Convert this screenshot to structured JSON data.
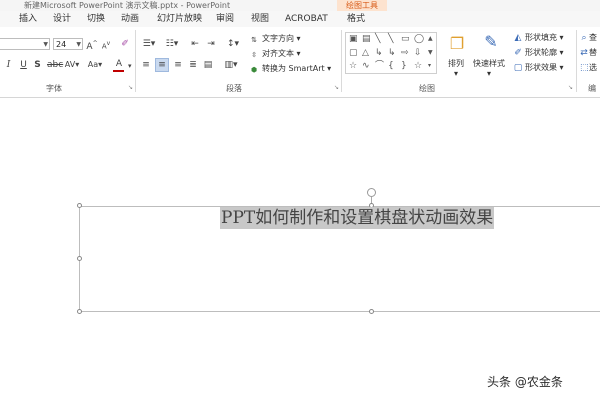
{
  "window": {
    "title": "新建Microsoft PowerPoint 演示文稿.pptx - PowerPoint",
    "context_group": "绘图工具"
  },
  "tabs": [
    "插入",
    "设计",
    "切换",
    "动画",
    "幻灯片放映",
    "审阅",
    "视图",
    "ACROBAT",
    "格式"
  ],
  "ribbon": {
    "font": {
      "size": "24",
      "group_label": "字体",
      "grow_icon": "font-grow-icon",
      "shrink_icon": "font-shrink-icon",
      "clear_icon": "clear-format-icon",
      "spacing_label": "AV",
      "case_label": "Aa",
      "color_label": "A",
      "font_color": "#c00000"
    },
    "paragraph": {
      "group_label": "段落",
      "text_direction": "文字方向",
      "align_text": "对齐文本",
      "convert_smartart": "转换为 SmartArt"
    },
    "drawing": {
      "group_label": "绘图",
      "arrange": "排列",
      "quick_styles": "快速样式",
      "shape_fill": "形状填充",
      "shape_outline": "形状轮廓",
      "shape_effects": "形状效果"
    },
    "editing": {
      "find": "查",
      "replace": "替",
      "select": "选",
      "group_label": "编"
    }
  },
  "slide": {
    "title_text": "PPT如何制作和设置棋盘状动画效果"
  },
  "watermark": "头条 @农金条"
}
